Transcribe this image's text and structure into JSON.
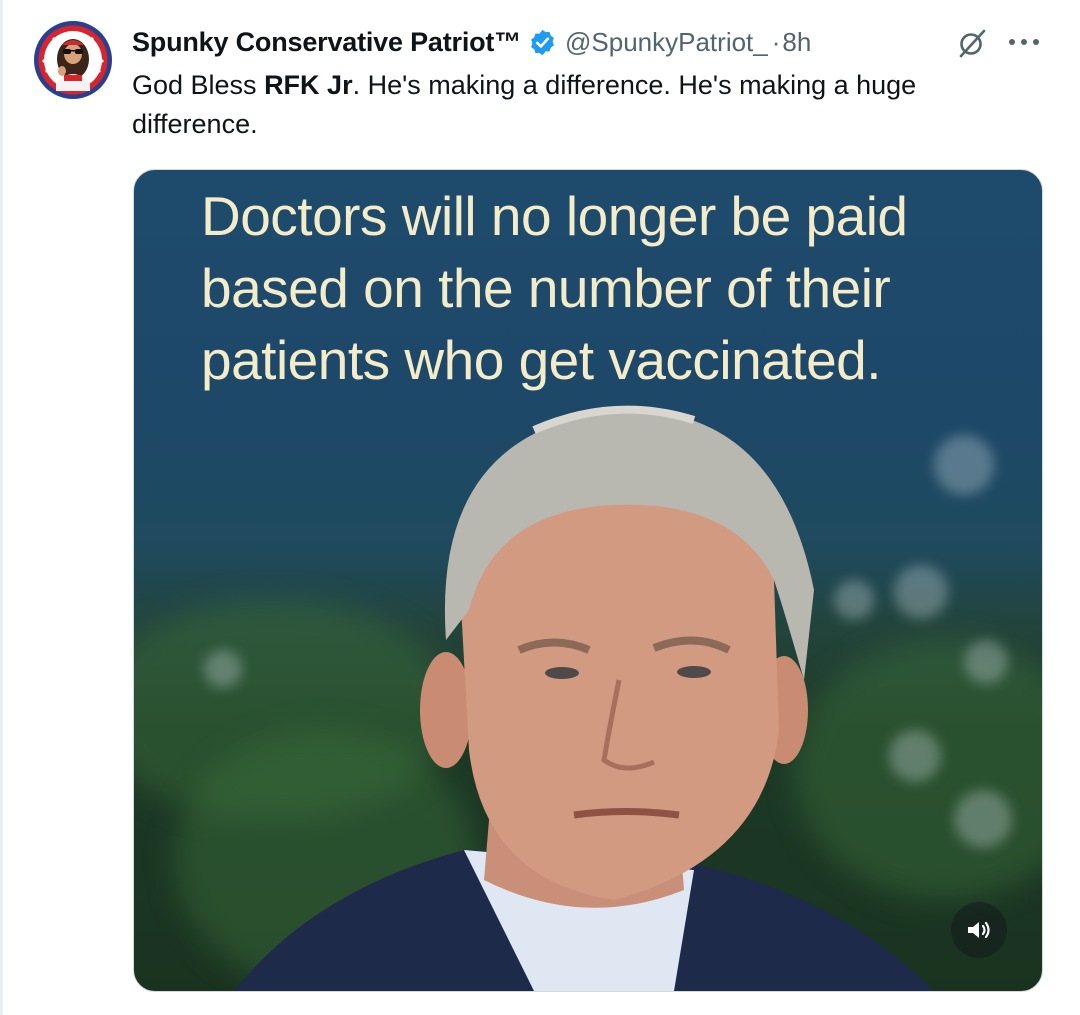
{
  "post": {
    "author": {
      "display_name": "Spunky Conservative Patriot™",
      "verified": true,
      "handle": "@SpunkyPatriot_",
      "separator": "·",
      "time": "8h"
    },
    "text": {
      "part1": "God Bless ",
      "bold": "RFK Jr",
      "part2": ". He's making a difference. He's making a huge difference."
    },
    "media": {
      "type": "video",
      "caption": "Doctors will no longer be paid based on the number of their patients who get vaccinated.",
      "sound_icon": "speaker-icon"
    },
    "actions": {
      "grok_icon": "grok-icon",
      "more_icon": "more-icon"
    }
  },
  "colors": {
    "verified_badge": "#1d9bf0",
    "secondary_text": "#536471",
    "caption_text": "#f4ecc8"
  }
}
